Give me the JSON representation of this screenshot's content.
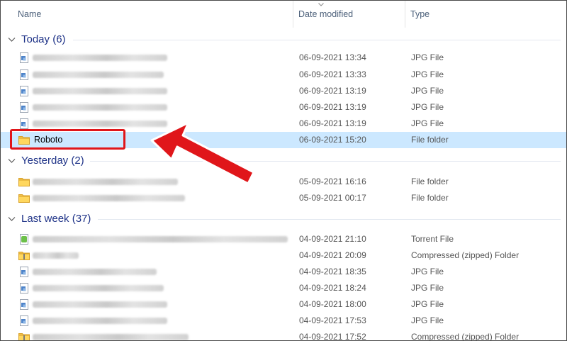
{
  "header": {
    "name_label": "Name",
    "date_label": "Date modified",
    "type_label": "Type"
  },
  "groups": [
    {
      "title": "Today (6)",
      "rows": [
        {
          "icon": "jpg-file-icon",
          "date": "06-09-2021 13:34",
          "type": "JPG File"
        },
        {
          "icon": "jpg-file-icon",
          "date": "06-09-2021 13:33",
          "type": "JPG File"
        },
        {
          "icon": "jpg-file-icon",
          "date": "06-09-2021 13:19",
          "type": "JPG File"
        },
        {
          "icon": "jpg-file-icon",
          "date": "06-09-2021 13:19",
          "type": "JPG File"
        },
        {
          "icon": "jpg-file-icon",
          "date": "06-09-2021 13:19",
          "type": "JPG File"
        },
        {
          "icon": "folder-icon",
          "name": "Roboto",
          "date": "06-09-2021 15:20",
          "type": "File folder",
          "selected": true
        }
      ]
    },
    {
      "title": "Yesterday (2)",
      "rows": [
        {
          "icon": "folder-icon",
          "date": "05-09-2021 16:16",
          "type": "File folder"
        },
        {
          "icon": "folder-icon",
          "date": "05-09-2021 00:17",
          "type": "File folder"
        }
      ]
    },
    {
      "title": "Last week (37)",
      "rows": [
        {
          "icon": "torrent-file-icon",
          "date": "04-09-2021 21:10",
          "type": "Torrent File"
        },
        {
          "icon": "zip-folder-icon",
          "date": "04-09-2021 20:09",
          "type": "Compressed (zipped) Folder"
        },
        {
          "icon": "jpg-file-icon",
          "date": "04-09-2021 18:35",
          "type": "JPG File"
        },
        {
          "icon": "jpg-file-icon",
          "date": "04-09-2021 18:24",
          "type": "JPG File"
        },
        {
          "icon": "jpg-file-icon",
          "date": "04-09-2021 18:00",
          "type": "JPG File"
        },
        {
          "icon": "jpg-file-icon",
          "date": "04-09-2021 17:53",
          "type": "JPG File"
        },
        {
          "icon": "zip-folder-icon",
          "date": "04-09-2021 17:52",
          "type": "Compressed (zipped) Folder"
        }
      ]
    }
  ],
  "colors": {
    "group_title": "#1e3287",
    "selection": "#cce8ff",
    "annotation_red": "#e0161a"
  }
}
